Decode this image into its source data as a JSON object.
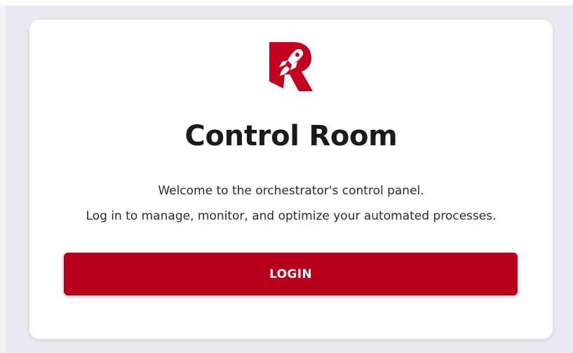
{
  "brand": {
    "logo_icon": "rocket-r-logo-icon",
    "accent_color": "#b7001b"
  },
  "card": {
    "title": "Control Room",
    "welcome_line": "Welcome to the orchestrator's control panel.",
    "instruction_line": "Log in to manage, monitor, and optimize your automated processes."
  },
  "actions": {
    "login_label": "LOGIN"
  }
}
